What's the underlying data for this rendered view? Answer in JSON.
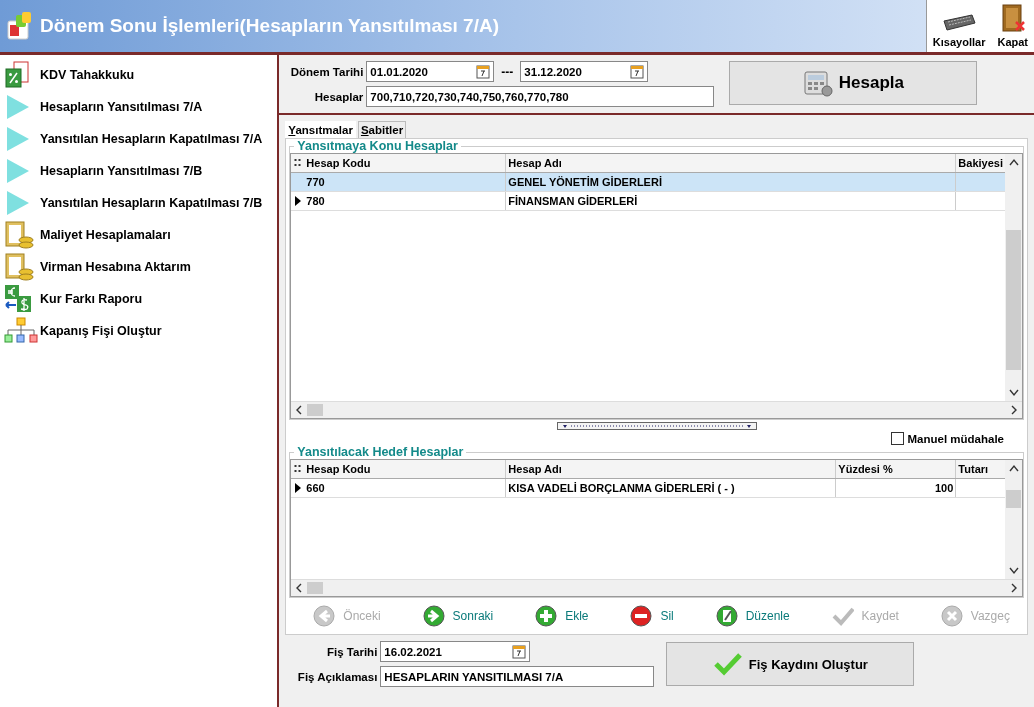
{
  "window": {
    "title": "Dönem Sonu İşlemleri(Hesapların Yansıtılması 7/A)"
  },
  "title_actions": [
    {
      "label": "Kısayollar",
      "kind": "keyboard"
    },
    {
      "label": "Kapat",
      "kind": "close"
    }
  ],
  "sidebar": {
    "items": [
      {
        "label": "KDV Tahakkuku",
        "kind": "percent"
      },
      {
        "label": "Hesapların Yansıtılması 7/A",
        "kind": "arrow"
      },
      {
        "label": "Yansıtılan Hesapların Kapatılması 7/A",
        "kind": "arrow"
      },
      {
        "label": "Hesapların Yansıtılması 7/B",
        "kind": "arrow"
      },
      {
        "label": "Yansıtılan Hesapların Kapatılması 7/B",
        "kind": "arrow"
      },
      {
        "label": "Maliyet Hesaplamaları",
        "kind": "coins"
      },
      {
        "label": "Virman Hesabına Aktarım",
        "kind": "coins"
      },
      {
        "label": "Kur Farkı Raporu",
        "kind": "currency"
      },
      {
        "label": "Kapanış Fişi Oluştur",
        "kind": "tree"
      }
    ]
  },
  "period": {
    "label": "Dönem Tarihi",
    "start": "01.01.2020",
    "separator": "---",
    "end": "31.12.2020"
  },
  "accounts": {
    "label": "Hesaplar",
    "value": "700,710,720,730,740,750,760,770,780"
  },
  "calculate_button": "Hesapla",
  "tabs": [
    {
      "label": "Yansıtmalar",
      "selected": true
    },
    {
      "label": "Sabitler",
      "selected": false
    }
  ],
  "source_group": {
    "title": "Yansıtmaya Konu Hesaplar",
    "columns": [
      "Hesap Kodu",
      "Hesap Adı",
      "Bakiyesi"
    ],
    "rows": [
      {
        "cells": [
          "770",
          "GENEL YÖNETİM GİDERLERİ",
          ""
        ],
        "selected": true,
        "current": false
      },
      {
        "cells": [
          "780",
          "FİNANSMAN GİDERLERİ",
          ""
        ],
        "selected": false,
        "current": true
      }
    ]
  },
  "manual": {
    "label": "Manuel müdahale",
    "checked": false
  },
  "target_group": {
    "title": "Yansıtılacak Hedef Hesaplar",
    "columns": [
      "Hesap Kodu",
      "Hesap Adı",
      "Yüzdesi %",
      "Tutarı"
    ],
    "rows": [
      {
        "cells": [
          "660",
          "KISA VADELİ BORÇLANMA GİDERLERİ ( - )",
          "100",
          ""
        ],
        "selected": false,
        "current": true
      }
    ]
  },
  "toolbar": [
    {
      "label": "Önceki",
      "kind": "prev",
      "disabled": true
    },
    {
      "label": "Sonraki",
      "kind": "next",
      "disabled": false
    },
    {
      "label": "Ekle",
      "kind": "add",
      "disabled": false
    },
    {
      "label": "Sil",
      "kind": "delete",
      "disabled": false
    },
    {
      "label": "Düzenle",
      "kind": "edit",
      "disabled": false
    },
    {
      "label": "Kaydet",
      "kind": "save",
      "disabled": true
    },
    {
      "label": "Vazgeç",
      "kind": "cancel",
      "disabled": true
    }
  ],
  "voucher": {
    "date_label": "Fiş Tarihi",
    "date": "16.02.2021",
    "desc_label": "Fiş Açıklaması",
    "desc": "HESAPLARIN YANSITILMASI 7/A",
    "button": "Fiş Kaydını Oluştur"
  }
}
